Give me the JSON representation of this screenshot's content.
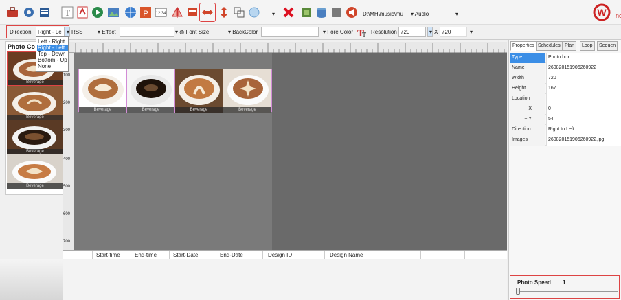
{
  "toolbar": {
    "path_text": "D:\\MH\\music\\mu",
    "audio_label": "Audio",
    "icons": [
      "briefcase-icon",
      "gear-icon",
      "list-icon",
      "text-icon",
      "pdf-icon",
      "video-icon",
      "image-icon",
      "web-icon",
      "ppt-icon",
      "clock-icon",
      "mirror-icon",
      "rect-icon",
      "arrow-h-icon",
      "arrow-v-icon",
      "group-icon",
      "globe-icon",
      "delete-icon",
      "layers-icon",
      "db-icon",
      "db2-icon",
      "audio-icon"
    ],
    "accent": "#cc2222"
  },
  "toolbar2": {
    "direction_label": "Direction",
    "direction_value": "Right - Le",
    "rss_label": "RSS",
    "effect_label": "Effect",
    "font_size_label": "Font Size",
    "back_color_label": "BackColor",
    "fore_color_label": "Fore Color",
    "resolution_label": "Resolution",
    "resolution_w": "720",
    "resolution_x": "X",
    "resolution_h": "720"
  },
  "dropdown": {
    "options": [
      "Left - Right",
      "Right - Left",
      "Top - Down",
      "Bottom - Up",
      "None"
    ],
    "selected_index": 1
  },
  "left_panel": {
    "title": "Photo Co",
    "thumb_label": "Beverage"
  },
  "ruler": {
    "left_marks": [
      "100",
      "200",
      "300",
      "400",
      "500",
      "600",
      "700"
    ]
  },
  "photostrip": {
    "label": "Beverage"
  },
  "grid": {
    "headers": [
      "Start-time",
      "End-time",
      "Start-Date",
      "End-Date",
      "Design ID",
      "Design Name"
    ]
  },
  "tabs": [
    "Properties",
    "Schedules",
    "Plan",
    "Loop",
    "Sequen"
  ],
  "properties": [
    {
      "key": "Type",
      "value": "Photo box"
    },
    {
      "key": "Name",
      "value": "260820151906260922"
    },
    {
      "key": "Width",
      "value": "720"
    },
    {
      "key": "Height",
      "value": "167"
    },
    {
      "key": "Location",
      "value": ""
    },
    {
      "key": "+ X",
      "value": "0"
    },
    {
      "key": "+ Y",
      "value": "54"
    },
    {
      "key": "Direction",
      "value": "Right to Left"
    },
    {
      "key": "Images",
      "value": "260820151906260922.jpg"
    }
  ],
  "speed": {
    "label": "Photo Speed",
    "value": "1"
  }
}
